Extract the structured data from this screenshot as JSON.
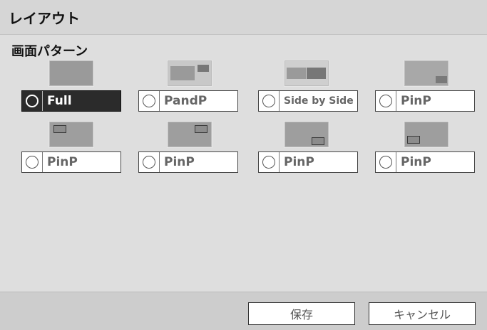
{
  "window": {
    "title": "レイアウト"
  },
  "section": {
    "label": "画面パターン"
  },
  "patterns": [
    {
      "label": "Full",
      "selected": true,
      "thumb": "full-screen"
    },
    {
      "label": "PandP",
      "selected": false,
      "thumb": "picture-and-picture"
    },
    {
      "label": "Side by Side",
      "selected": false,
      "thumb": "side-by-side"
    },
    {
      "label": "PinP",
      "selected": false,
      "thumb": "pinp-bottom-right"
    },
    {
      "label": "PinP",
      "selected": false,
      "thumb": "pinp-top-left"
    },
    {
      "label": "PinP",
      "selected": false,
      "thumb": "pinp-top-right"
    },
    {
      "label": "PinP",
      "selected": false,
      "thumb": "pinp-bottom-right"
    },
    {
      "label": "PinP",
      "selected": false,
      "thumb": "pinp-bottom-left"
    }
  ],
  "footer": {
    "save_label": "保存",
    "cancel_label": "キャンセル"
  },
  "colors": {
    "selected_bg": "#2b2b2b",
    "dialog_bg": "#dedede"
  }
}
